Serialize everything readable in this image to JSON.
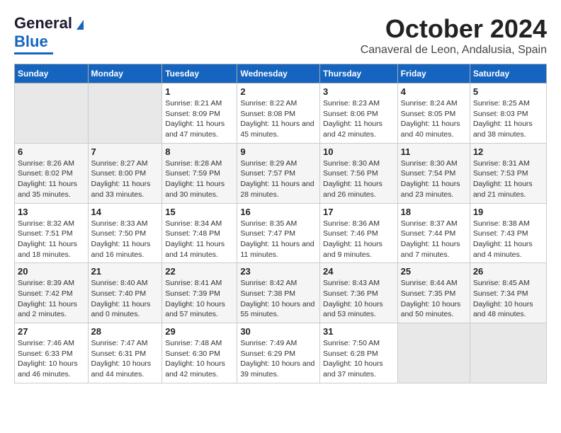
{
  "header": {
    "logo_line1": "General",
    "logo_line2": "Blue",
    "title": "October 2024",
    "subtitle": "Canaveral de Leon, Andalusia, Spain"
  },
  "columns": [
    "Sunday",
    "Monday",
    "Tuesday",
    "Wednesday",
    "Thursday",
    "Friday",
    "Saturday"
  ],
  "weeks": [
    {
      "days": [
        {
          "num": "",
          "info": ""
        },
        {
          "num": "",
          "info": ""
        },
        {
          "num": "1",
          "info": "Sunrise: 8:21 AM\nSunset: 8:09 PM\nDaylight: 11 hours and 47 minutes."
        },
        {
          "num": "2",
          "info": "Sunrise: 8:22 AM\nSunset: 8:08 PM\nDaylight: 11 hours and 45 minutes."
        },
        {
          "num": "3",
          "info": "Sunrise: 8:23 AM\nSunset: 8:06 PM\nDaylight: 11 hours and 42 minutes."
        },
        {
          "num": "4",
          "info": "Sunrise: 8:24 AM\nSunset: 8:05 PM\nDaylight: 11 hours and 40 minutes."
        },
        {
          "num": "5",
          "info": "Sunrise: 8:25 AM\nSunset: 8:03 PM\nDaylight: 11 hours and 38 minutes."
        }
      ]
    },
    {
      "days": [
        {
          "num": "6",
          "info": "Sunrise: 8:26 AM\nSunset: 8:02 PM\nDaylight: 11 hours and 35 minutes."
        },
        {
          "num": "7",
          "info": "Sunrise: 8:27 AM\nSunset: 8:00 PM\nDaylight: 11 hours and 33 minutes."
        },
        {
          "num": "8",
          "info": "Sunrise: 8:28 AM\nSunset: 7:59 PM\nDaylight: 11 hours and 30 minutes."
        },
        {
          "num": "9",
          "info": "Sunrise: 8:29 AM\nSunset: 7:57 PM\nDaylight: 11 hours and 28 minutes."
        },
        {
          "num": "10",
          "info": "Sunrise: 8:30 AM\nSunset: 7:56 PM\nDaylight: 11 hours and 26 minutes."
        },
        {
          "num": "11",
          "info": "Sunrise: 8:30 AM\nSunset: 7:54 PM\nDaylight: 11 hours and 23 minutes."
        },
        {
          "num": "12",
          "info": "Sunrise: 8:31 AM\nSunset: 7:53 PM\nDaylight: 11 hours and 21 minutes."
        }
      ]
    },
    {
      "days": [
        {
          "num": "13",
          "info": "Sunrise: 8:32 AM\nSunset: 7:51 PM\nDaylight: 11 hours and 18 minutes."
        },
        {
          "num": "14",
          "info": "Sunrise: 8:33 AM\nSunset: 7:50 PM\nDaylight: 11 hours and 16 minutes."
        },
        {
          "num": "15",
          "info": "Sunrise: 8:34 AM\nSunset: 7:48 PM\nDaylight: 11 hours and 14 minutes."
        },
        {
          "num": "16",
          "info": "Sunrise: 8:35 AM\nSunset: 7:47 PM\nDaylight: 11 hours and 11 minutes."
        },
        {
          "num": "17",
          "info": "Sunrise: 8:36 AM\nSunset: 7:46 PM\nDaylight: 11 hours and 9 minutes."
        },
        {
          "num": "18",
          "info": "Sunrise: 8:37 AM\nSunset: 7:44 PM\nDaylight: 11 hours and 7 minutes."
        },
        {
          "num": "19",
          "info": "Sunrise: 8:38 AM\nSunset: 7:43 PM\nDaylight: 11 hours and 4 minutes."
        }
      ]
    },
    {
      "days": [
        {
          "num": "20",
          "info": "Sunrise: 8:39 AM\nSunset: 7:42 PM\nDaylight: 11 hours and 2 minutes."
        },
        {
          "num": "21",
          "info": "Sunrise: 8:40 AM\nSunset: 7:40 PM\nDaylight: 11 hours and 0 minutes."
        },
        {
          "num": "22",
          "info": "Sunrise: 8:41 AM\nSunset: 7:39 PM\nDaylight: 10 hours and 57 minutes."
        },
        {
          "num": "23",
          "info": "Sunrise: 8:42 AM\nSunset: 7:38 PM\nDaylight: 10 hours and 55 minutes."
        },
        {
          "num": "24",
          "info": "Sunrise: 8:43 AM\nSunset: 7:36 PM\nDaylight: 10 hours and 53 minutes."
        },
        {
          "num": "25",
          "info": "Sunrise: 8:44 AM\nSunset: 7:35 PM\nDaylight: 10 hours and 50 minutes."
        },
        {
          "num": "26",
          "info": "Sunrise: 8:45 AM\nSunset: 7:34 PM\nDaylight: 10 hours and 48 minutes."
        }
      ]
    },
    {
      "days": [
        {
          "num": "27",
          "info": "Sunrise: 7:46 AM\nSunset: 6:33 PM\nDaylight: 10 hours and 46 minutes."
        },
        {
          "num": "28",
          "info": "Sunrise: 7:47 AM\nSunset: 6:31 PM\nDaylight: 10 hours and 44 minutes."
        },
        {
          "num": "29",
          "info": "Sunrise: 7:48 AM\nSunset: 6:30 PM\nDaylight: 10 hours and 42 minutes."
        },
        {
          "num": "30",
          "info": "Sunrise: 7:49 AM\nSunset: 6:29 PM\nDaylight: 10 hours and 39 minutes."
        },
        {
          "num": "31",
          "info": "Sunrise: 7:50 AM\nSunset: 6:28 PM\nDaylight: 10 hours and 37 minutes."
        },
        {
          "num": "",
          "info": ""
        },
        {
          "num": "",
          "info": ""
        }
      ]
    }
  ]
}
